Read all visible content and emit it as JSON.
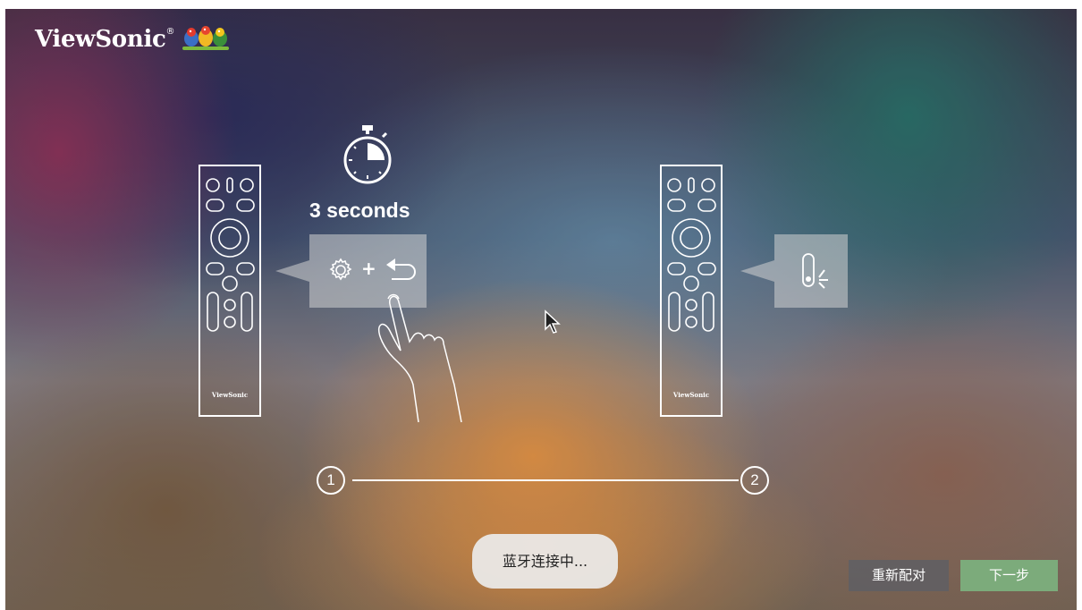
{
  "brand": {
    "name": "ViewSonic",
    "reg": "®"
  },
  "remote_left": {
    "brand": "ViewSonic"
  },
  "remote_right": {
    "brand": "ViewSonic"
  },
  "instruction": {
    "duration_text": "3 seconds",
    "plus": "+"
  },
  "steps": [
    "1",
    "2"
  ],
  "status": {
    "text": "蓝牙连接中..."
  },
  "buttons": {
    "rematch": "重新配对",
    "next": "下一步"
  },
  "colors": {
    "next_button": "#7cab7b",
    "rematch_button": "#5f5f64"
  },
  "icons": [
    "stopwatch-icon",
    "gear-icon",
    "back-arrow-icon",
    "led-indicator-icon",
    "pointing-hand-icon",
    "mouse-pointer-icon"
  ]
}
